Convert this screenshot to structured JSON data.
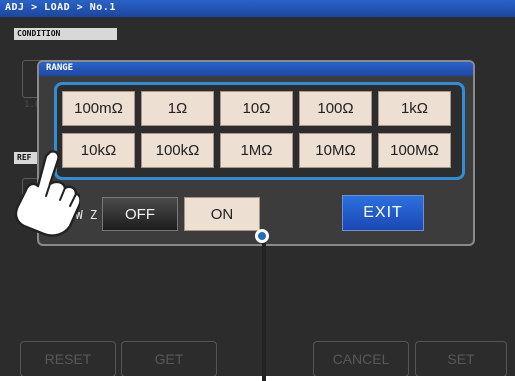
{
  "breadcrumb": "ADJ > LOAD > No.1",
  "sections": {
    "condition": "CONDITION",
    "ref": "REF"
  },
  "dialog": {
    "title": "RANGE",
    "range_buttons": [
      "100mΩ",
      "1Ω",
      "10Ω",
      "100Ω",
      "1kΩ",
      "10kΩ",
      "100kΩ",
      "1MΩ",
      "10MΩ",
      "100MΩ"
    ],
    "lowz_label": "LOW Z",
    "off_label": "OFF",
    "on_label": "ON",
    "exit_label": "EXIT"
  },
  "background_fragments": {
    "left_text": "1.0"
  },
  "bottom_bar": {
    "reset": "RESET",
    "get": "GET",
    "cancel": "CANCEL",
    "set": "SET"
  },
  "colors": {
    "accent_blue": "#2a63c8",
    "range_frame": "#2f8fd6",
    "button_face": "#eddfd2",
    "exit_button": "#1f5bd0"
  },
  "icons": {
    "hand": "pointing-hand-icon",
    "pointer": "callout-dot-icon"
  }
}
